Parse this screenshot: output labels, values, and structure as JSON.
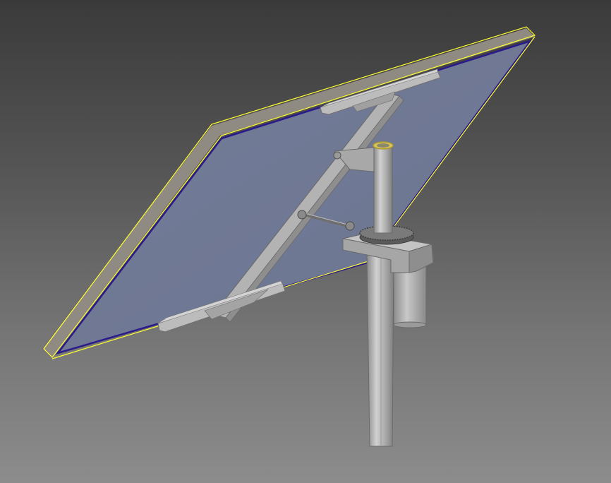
{
  "viewport": {
    "background_top": "#3a3a3a",
    "background_bottom": "#8c8c8c"
  },
  "model": {
    "description_colors": {
      "panel_face": "#707a95",
      "panel_frame": "#8f8a82",
      "selection_outline": "#ffff33",
      "edge_highlight": "#2a1a8a",
      "metal": "#b5b5b5",
      "pole_cap": "#d8c45a"
    }
  }
}
